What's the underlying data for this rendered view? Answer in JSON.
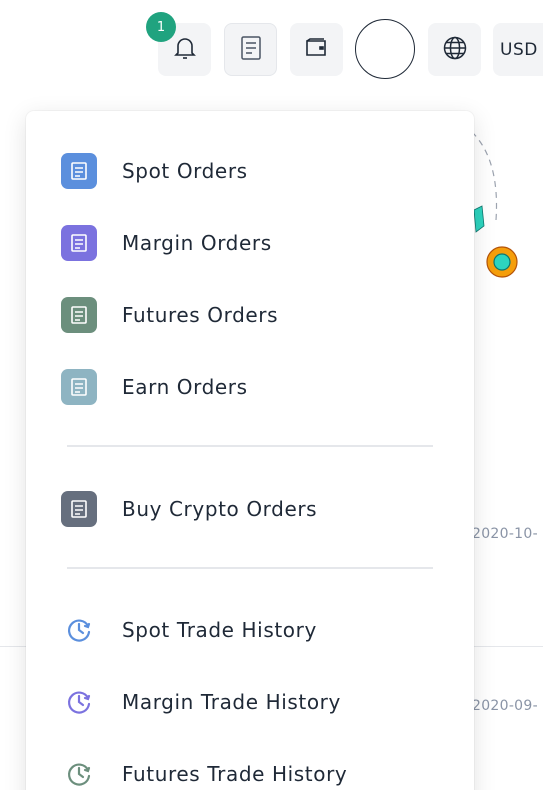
{
  "topbar": {
    "notification_count": "1",
    "currency_label": "USD"
  },
  "background": {
    "date_1": "2020-10-",
    "date_2": "2020-09-"
  },
  "menu": {
    "orders": [
      {
        "label": "Spot Orders",
        "color": "#5b8fdd"
      },
      {
        "label": "Margin Orders",
        "color": "#7b72df"
      },
      {
        "label": "Futures Orders",
        "color": "#6c8f7d"
      },
      {
        "label": "Earn Orders",
        "color": "#8eb4c2"
      }
    ],
    "buy_crypto": {
      "label": "Buy Crypto Orders",
      "color": "#666f7e"
    },
    "history": [
      {
        "label": "Spot Trade History",
        "color": "#5b8fdd"
      },
      {
        "label": "Margin Trade History",
        "color": "#7b72df"
      },
      {
        "label": "Futures Trade History",
        "color": "#6c8f7d"
      }
    ]
  }
}
